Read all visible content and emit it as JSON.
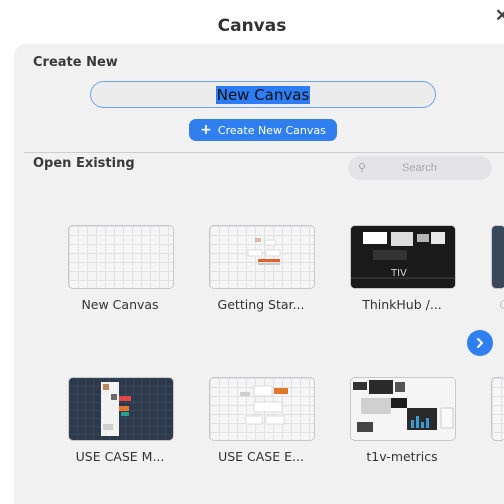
{
  "window": {
    "title": "Canvas",
    "close_label": "✕"
  },
  "create_new": {
    "label": "Create New",
    "name_value": "New Canvas",
    "button_label": "Create New Canvas",
    "button_plus": "+"
  },
  "open_existing": {
    "label": "Open Existing",
    "search_placeholder": "Search",
    "search_icon": "⚲",
    "row1": [
      {
        "caption": "New Canvas",
        "icon": "blank-canvas"
      },
      {
        "caption": "Getting Star...",
        "icon": "getting-started-canvas"
      },
      {
        "caption": "ThinkHub /...",
        "icon": "thinkhub-canvas"
      },
      {
        "caption": "C"
      }
    ],
    "row2": [
      {
        "caption": "USE CASE M...",
        "icon": "use-case-m-canvas"
      },
      {
        "caption": "USE CASE E...",
        "icon": "use-case-e-canvas"
      },
      {
        "caption": "t1v-metrics",
        "icon": "t1v-metrics-canvas"
      }
    ],
    "thinkhub_thumb_text": "TIV"
  },
  "colors": {
    "accent": "#2f80ee",
    "panel": "#f1f1f2"
  }
}
